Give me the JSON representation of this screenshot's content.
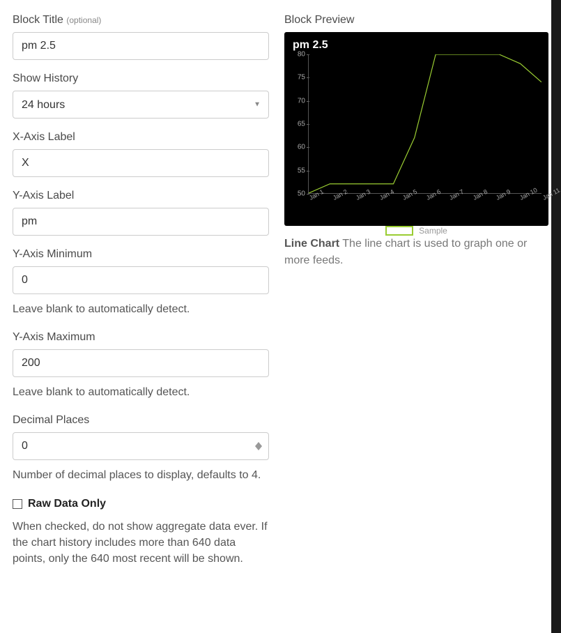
{
  "form": {
    "block_title": {
      "label": "Block Title",
      "optional_hint": "(optional)",
      "value": "pm 2.5"
    },
    "show_history": {
      "label": "Show History",
      "value": "24 hours"
    },
    "x_axis_label": {
      "label": "X-Axis Label",
      "value": "X"
    },
    "y_axis_label": {
      "label": "Y-Axis Label",
      "value": "pm"
    },
    "y_min": {
      "label": "Y-Axis Minimum",
      "value": "0",
      "help": "Leave blank to automatically detect."
    },
    "y_max": {
      "label": "Y-Axis Maximum",
      "value": "200",
      "help": "Leave blank to automatically detect."
    },
    "decimal_places": {
      "label": "Decimal Places",
      "value": "0",
      "help": "Number of decimal places to display, defaults to 4."
    },
    "raw_data_only": {
      "label": "Raw Data Only",
      "checked": false,
      "help": "When checked, do not show aggregate data ever. If the chart history includes more than 640 data points, only the 640 most recent will be shown."
    }
  },
  "preview": {
    "heading": "Block Preview",
    "title": "pm 2.5",
    "legend": "Sample",
    "desc_bold": "Line Chart",
    "desc_rest": " The line chart is used to graph one or more feeds."
  },
  "chart_data": {
    "type": "line",
    "title": "pm 2.5",
    "xlabel": "",
    "ylabel": "",
    "ylim": [
      50,
      80
    ],
    "y_ticks": [
      50,
      55,
      60,
      65,
      70,
      75,
      80
    ],
    "categories": [
      "Jan 1",
      "Jan 2",
      "Jan 3",
      "Jan 4",
      "Jan 5",
      "Jan 6",
      "Jan 7",
      "Jan 8",
      "Jan 9",
      "Jan 10",
      "Jan 11"
    ],
    "series": [
      {
        "name": "Sample",
        "color": "#9acd32",
        "values": [
          50,
          52,
          52,
          52,
          52,
          62,
          80,
          80,
          80,
          80,
          78,
          74
        ]
      }
    ],
    "legend_position": "bottom"
  }
}
